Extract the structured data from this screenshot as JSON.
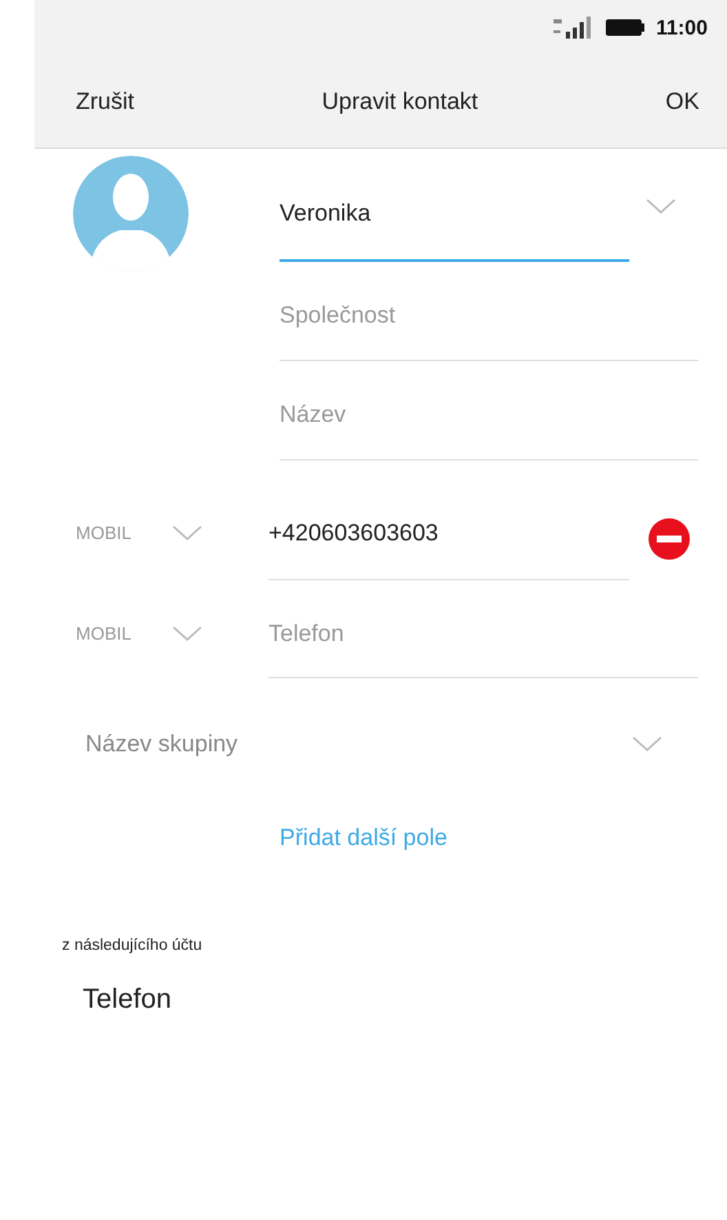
{
  "status_bar": {
    "time": "11:00"
  },
  "header": {
    "cancel": "Zrušit",
    "title": "Upravit kontakt",
    "confirm": "OK"
  },
  "name_fields": [
    {
      "value": "Veronika",
      "focused": true,
      "expandable": true
    },
    {
      "placeholder": "Společnost",
      "focused": false,
      "expandable": false
    },
    {
      "placeholder": "Název",
      "focused": false,
      "expandable": false
    }
  ],
  "phones": [
    {
      "type": "MOBIL",
      "value": "+420603603603",
      "removable": true
    },
    {
      "type": "MOBIL",
      "placeholder": "Telefon",
      "removable": false
    }
  ],
  "group": {
    "placeholder": "Název skupiny"
  },
  "add_field_link": "Přidat další pole",
  "account": {
    "caption": "z následujícího účtu",
    "name": "Telefon"
  }
}
